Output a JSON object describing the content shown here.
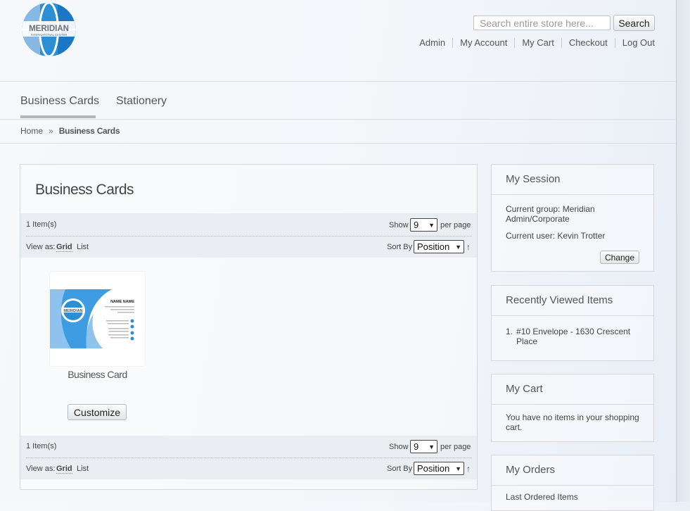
{
  "brand": {
    "logo_text": "MERIDIAN",
    "logo_subtext": "INTERNATIONAL CENTER"
  },
  "search": {
    "placeholder": "Search entire store here...",
    "button_label": "Search"
  },
  "top_links": [
    "Admin",
    "My Account",
    "My Cart",
    "Checkout",
    "Log Out"
  ],
  "nav": {
    "items": [
      "Business Cards",
      "Stationery"
    ],
    "active": "Business Cards"
  },
  "breadcrumb": {
    "home": "Home",
    "separator": "»",
    "current": "Business Cards"
  },
  "category": {
    "title": "Business Cards",
    "item_count": "1 Item(s)",
    "show_label": "Show",
    "per_page_value": "9",
    "per_page_label": "per page",
    "view_as_label": "View as:",
    "view_grid": "Grid",
    "view_list": "List",
    "sort_by_label": "Sort By",
    "sort_value": "Position",
    "sort_direction_icon": "arrow-up-icon"
  },
  "product": {
    "name": "Business Card",
    "button_label": "Customize",
    "card": {
      "name_text": "NAME NAME",
      "logo_text": "MERIDIAN"
    }
  },
  "sidebar": {
    "session": {
      "title": "My Session",
      "group_line": "Current group: Meridian Admin/Corporate",
      "user_line": "Current user: Kevin Trotter",
      "button_label": "Change"
    },
    "recently_viewed": {
      "title": "Recently Viewed Items",
      "items": [
        "#10 Envelope - 1630 Crescent Place"
      ]
    },
    "cart": {
      "title": "My Cart",
      "empty_text": "You have no items in your shopping cart."
    },
    "orders": {
      "title": "My Orders",
      "last_ordered": "Last Ordered Items"
    }
  },
  "colors": {
    "brand_blue": "#1e88d4",
    "light_blue": "#7fb8e6",
    "toolbar_bg": "#eaedf1"
  }
}
